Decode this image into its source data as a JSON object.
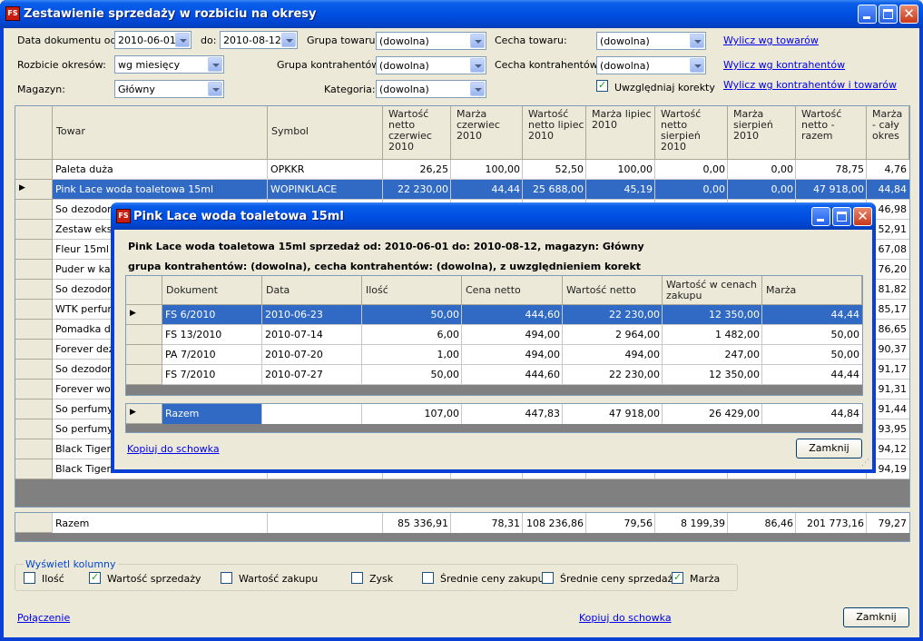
{
  "window": {
    "title": "Zestawienie sprzedaży w rozbiciu na okresy",
    "icon": "app-logo-icon"
  },
  "filters": {
    "date_from_label": "Data dokumentu od:",
    "date_from": "2010-06-01",
    "date_to_label": "do:",
    "date_to": "2010-08-12",
    "breakdown_label": "Rozbicie okresów:",
    "breakdown": "wg miesięcy",
    "warehouse_label": "Magazyn:",
    "warehouse": "Główny",
    "product_group_label": "Grupa towaru:",
    "product_group": "(dowolna)",
    "contractor_group_label": "Grupa kontrahentów:",
    "contractor_group": "(dowolna)",
    "category_label": "Kategoria:",
    "category": "(dowolna)",
    "product_feature_label": "Cecha towaru:",
    "product_feature": "(dowolna)",
    "contractor_feature_label": "Cecha kontrahentów:",
    "contractor_feature": "(dowolna)",
    "corrections_label": "Uwzględniaj korekty",
    "corrections_checked": true
  },
  "links": {
    "by_products": "Wylicz wg towarów",
    "by_contractors": "Wylicz wg kontrahentów",
    "by_both": "Wylicz wg kontrahentów i towarów",
    "connection": "Połączenie",
    "copy": "Kopiuj do schowka"
  },
  "main_table": {
    "headers": [
      "Towar",
      "Symbol",
      "Wartość netto czerwiec 2010",
      "Marża czerwiec 2010",
      "Wartość netto lipiec 2010",
      "Marża lipiec 2010",
      "Wartość netto sierpień 2010",
      "Marża sierpień 2010",
      "Wartość netto - razem",
      "Marża - cały okres"
    ],
    "rows": [
      {
        "towar": "Paleta duża",
        "symbol": "OPKKR",
        "v": [
          "26,25",
          "100,00",
          "52,50",
          "100,00",
          "0,00",
          "0,00",
          "78,75",
          "4,76"
        ],
        "selected": false
      },
      {
        "towar": "Pink Lace woda toaletowa 15ml",
        "symbol": "WOPINKLACE",
        "v": [
          "22 230,00",
          "44,44",
          "25 688,00",
          "45,19",
          "0,00",
          "0,00",
          "47 918,00",
          "44,84"
        ],
        "selected": true
      },
      {
        "towar": "So dezodora",
        "symbol": "",
        "v": [
          "",
          "",
          "",
          "",
          "",
          "",
          "",
          "46,98"
        ],
        "selected": false
      },
      {
        "towar": "Zestaw eksk",
        "symbol": "",
        "v": [
          "",
          "",
          "",
          "",
          "",
          "",
          "",
          "52,91"
        ],
        "selected": false
      },
      {
        "towar": "Fleur 15ml pe",
        "symbol": "",
        "v": [
          "",
          "",
          "",
          "",
          "",
          "",
          "",
          "67,08"
        ],
        "selected": false
      },
      {
        "towar": "Puder w kam",
        "symbol": "",
        "v": [
          "",
          "",
          "",
          "",
          "",
          "",
          "",
          "76,20"
        ],
        "selected": false
      },
      {
        "towar": "So dezodora",
        "symbol": "",
        "v": [
          "",
          "",
          "",
          "",
          "",
          "",
          "",
          "81,82"
        ],
        "selected": false
      },
      {
        "towar": "WTK perfum",
        "symbol": "",
        "v": [
          "",
          "",
          "",
          "",
          "",
          "",
          "",
          "85,17"
        ],
        "selected": false
      },
      {
        "towar": "Pomadka dł",
        "symbol": "",
        "v": [
          "",
          "",
          "",
          "",
          "",
          "",
          "",
          "86,65"
        ],
        "selected": false
      },
      {
        "towar": "Forever dezo",
        "symbol": "",
        "v": [
          "",
          "",
          "",
          "",
          "",
          "",
          "",
          "90,37"
        ],
        "selected": false
      },
      {
        "towar": "So dezodora",
        "symbol": "",
        "v": [
          "",
          "",
          "",
          "",
          "",
          "",
          "",
          "91,17"
        ],
        "selected": false
      },
      {
        "towar": "Forever wod",
        "symbol": "",
        "v": [
          "",
          "",
          "",
          "",
          "",
          "",
          "",
          "91,31"
        ],
        "selected": false
      },
      {
        "towar": "So perfumy 2",
        "symbol": "",
        "v": [
          "",
          "",
          "",
          "",
          "",
          "",
          "",
          "91,44"
        ],
        "selected": false
      },
      {
        "towar": "So perfumy 5",
        "symbol": "",
        "v": [
          "",
          "",
          "",
          "",
          "",
          "",
          "",
          "93,95"
        ],
        "selected": false
      },
      {
        "towar": "Black Tiger w",
        "symbol": "",
        "v": [
          "",
          "",
          "",
          "",
          "",
          "",
          "",
          "94,12"
        ],
        "selected": false
      },
      {
        "towar": "Black Tiger w",
        "symbol": "",
        "v": [
          "",
          "",
          "",
          "",
          "",
          "",
          "",
          "94,19"
        ],
        "selected": false
      }
    ],
    "total": {
      "label": "Razem",
      "v": [
        "85 336,91",
        "78,31",
        "108 236,86",
        "79,56",
        "8 199,39",
        "86,46",
        "201 773,16",
        "79,27"
      ]
    }
  },
  "columns_group": {
    "title": "Wyświetl kolumny",
    "options": [
      {
        "label": "Ilość",
        "checked": false
      },
      {
        "label": "Wartość sprzedaży",
        "checked": true
      },
      {
        "label": "Wartość zakupu",
        "checked": false
      },
      {
        "label": "Zysk",
        "checked": false
      },
      {
        "label": "Średnie ceny zakupu",
        "checked": false
      },
      {
        "label": "Średnie ceny sprzedaży",
        "checked": false
      },
      {
        "label": "Marża",
        "checked": true
      }
    ]
  },
  "close_button": "Zamknij",
  "dialog": {
    "title": "Pink Lace woda toaletowa 15ml",
    "summary_line1": "Pink Lace woda toaletowa 15ml sprzedaż od: 2010-06-01 do: 2010-08-12, magazyn: Główny",
    "summary_line2": "grupa kontrahentów: (dowolna), cecha kontrahentów: (dowolna), z uwzględnieniem korekt",
    "headers": [
      "Dokument",
      "Data",
      "Ilość",
      "Cena netto",
      "Wartość netto",
      "Wartość w cenach zakupu",
      "Marża"
    ],
    "rows": [
      {
        "v": [
          "FS 6/2010",
          "2010-06-23",
          "50,00",
          "444,60",
          "22 230,00",
          "12 350,00",
          "44,44"
        ],
        "selected": true
      },
      {
        "v": [
          "FS 13/2010",
          "2010-07-14",
          "6,00",
          "494,00",
          "2 964,00",
          "1 482,00",
          "50,00"
        ],
        "selected": false
      },
      {
        "v": [
          "PA 7/2010",
          "2010-07-20",
          "1,00",
          "494,00",
          "494,00",
          "247,00",
          "50,00"
        ],
        "selected": false
      },
      {
        "v": [
          "FS 7/2010",
          "2010-07-27",
          "50,00",
          "444,60",
          "22 230,00",
          "12 350,00",
          "44,44"
        ],
        "selected": false
      }
    ],
    "total": {
      "v": [
        "Razem",
        "",
        "107,00",
        "447,83",
        "47 918,00",
        "26 429,00",
        "44,84"
      ]
    },
    "copy_link": "Kopiuj do schowka",
    "close_button": "Zamknij"
  }
}
